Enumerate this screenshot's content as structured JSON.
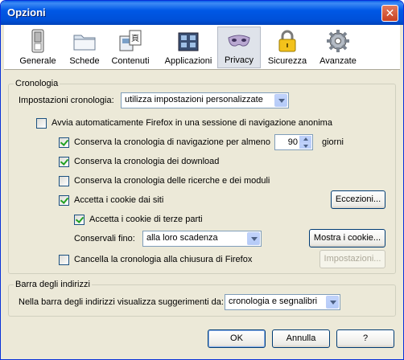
{
  "window": {
    "title": "Opzioni",
    "close_glyph": "✕"
  },
  "toolbar": {
    "tabs": [
      {
        "label": "Generale",
        "icon": "switch-icon"
      },
      {
        "label": "Schede",
        "icon": "folder-tabs-icon"
      },
      {
        "label": "Contenuti",
        "icon": "contents-icon"
      },
      {
        "label": "Applicazioni",
        "icon": "applications-icon"
      },
      {
        "label": "Privacy",
        "icon": "mask-icon",
        "active": true
      },
      {
        "label": "Sicurezza",
        "icon": "lock-icon"
      },
      {
        "label": "Avanzate",
        "icon": "gear-icon"
      }
    ]
  },
  "history": {
    "legend": "Cronologia",
    "settings_label": "Impostazioni cronologia:",
    "settings_value": "utilizza impostazioni personalizzate",
    "private_mode_label": "Avvia automaticamente Firefox in una sessione di navigazione anonima",
    "private_mode_checked": false,
    "keep_history_label": "Conserva la cronologia di navigazione per almeno",
    "keep_history_checked": true,
    "keep_history_days": "90",
    "days_label": "giorni",
    "download_history_label": "Conserva la cronologia dei download",
    "download_history_checked": true,
    "search_history_label": "Conserva la cronologia delle ricerche e dei moduli",
    "search_history_checked": false,
    "accept_cookies_label": "Accetta i cookie dai siti",
    "accept_cookies_checked": true,
    "exceptions_button": "Eccezioni...",
    "third_party_label": "Accetta i cookie di terze parti",
    "third_party_checked": true,
    "keep_until_label": "Conservali fino:",
    "keep_until_value": "alla loro scadenza",
    "show_cookies_button": "Mostra i cookie...",
    "clear_on_close_label": "Cancella la cronologia alla chiusura di Firefox",
    "clear_on_close_checked": false,
    "settings_button": "Impostazioni..."
  },
  "location_bar": {
    "legend": "Barra degli indirizzi",
    "suggest_label": "Nella barra degli indirizzi visualizza suggerimenti da:",
    "suggest_value": "cronologia e segnalibri"
  },
  "footer": {
    "ok": "OK",
    "cancel": "Annulla",
    "help": "?"
  }
}
